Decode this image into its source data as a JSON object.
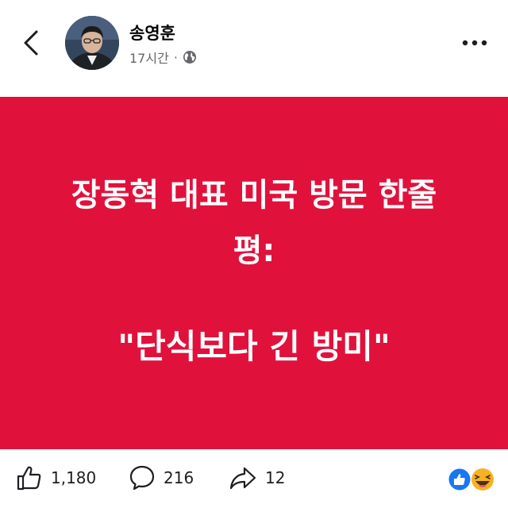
{
  "post": {
    "author": "송영훈",
    "time": "17시간",
    "separator": "·",
    "privacy_icon": "globe-icon"
  },
  "card": {
    "background": "#e0123c",
    "line1": "장동혁 대표 미국 방문 한줄",
    "line2": "평:",
    "line3": "\"단식보다 긴 방미\""
  },
  "actions": {
    "likes": "1,180",
    "comments": "216",
    "shares": "12"
  },
  "reactions": [
    "like-reaction-icon",
    "haha-reaction-icon"
  ]
}
